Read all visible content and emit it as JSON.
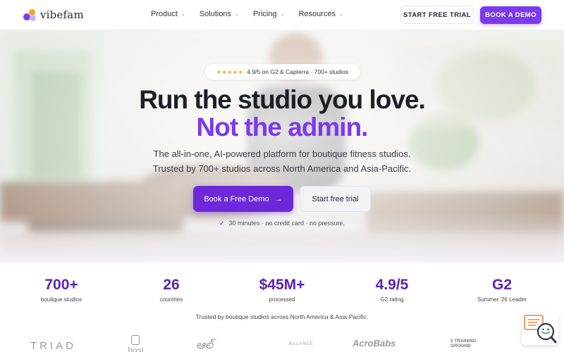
{
  "nav": {
    "logo": "vibefam",
    "menu": [
      {
        "label": "Product"
      },
      {
        "label": "Solutions"
      },
      {
        "label": "Pricing"
      },
      {
        "label": "Resources"
      }
    ],
    "start_trial": "START FREE TRIAL",
    "book_demo": "BOOK A DEMO"
  },
  "hero": {
    "badge_stars": "★★★★★",
    "badge_text": "4.9/5 on G2 & Capterra · 700+ studios",
    "headline_1": "Run the studio you love.",
    "headline_2": "Not the admin.",
    "subline_1": "The all-in-one, AI-powered platform for boutique fitness studios.",
    "subline_2": "Trusted by 700+ studios across North America and Asia-Pacific.",
    "cta_demo": "Book a Free Demo",
    "cta_demo_arrow": "→",
    "cta_trial": "Start free trial",
    "reassurance": "30 minutes · no credit card · no pressure."
  },
  "stats": [
    {
      "value": "700+",
      "label": "boutique studios"
    },
    {
      "value": "26",
      "label": "countries"
    },
    {
      "value": "$45M+",
      "label": "processed"
    },
    {
      "value": "4.9/5",
      "label": "G2 rating"
    },
    {
      "value": "G2",
      "label": "Summer '26 Leader"
    }
  ],
  "trusted_text": "Trusted by boutique studios across North America & Asia-Pacific.",
  "customer_logos": {
    "triad": "TRIAD",
    "bosi": "bosi",
    "script": "ఆల్",
    "small": "BALANCE",
    "round": "AcroBabs",
    "training_1": "5 TRAINING",
    "training_2": "GROUND"
  },
  "colors": {
    "accent": "#7c3aed",
    "accent_dark": "#6d28d9",
    "stat_value": "#5b21b6",
    "headline": "#1c1f26",
    "star": "#f5a623"
  }
}
